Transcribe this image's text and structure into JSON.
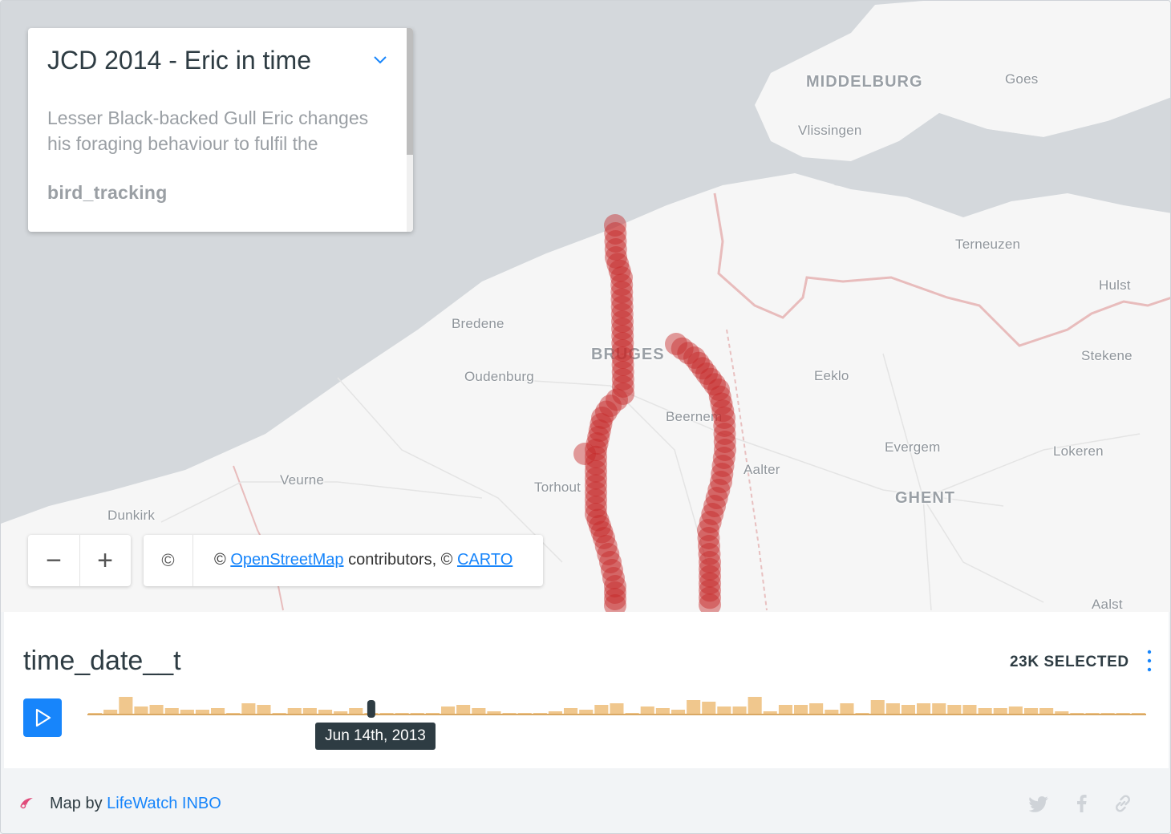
{
  "legend": {
    "title": "JCD 2014 - Eric in time",
    "description": "Lesser Black-backed Gull Eric changes his foraging behaviour to fulfil the",
    "layer_name": "bird_tracking"
  },
  "map": {
    "cities": [
      {
        "name": "MIDDELBURG",
        "major": true
      },
      {
        "name": "Goes",
        "major": false
      },
      {
        "name": "Vlissingen",
        "major": false
      },
      {
        "name": "Terneuzen",
        "major": false
      },
      {
        "name": "Hulst",
        "major": false
      },
      {
        "name": "Bredene",
        "major": false
      },
      {
        "name": "BRUGES",
        "major": true
      },
      {
        "name": "Oudenburg",
        "major": false
      },
      {
        "name": "Eeklo",
        "major": false
      },
      {
        "name": "Stekene",
        "major": false
      },
      {
        "name": "Beernem",
        "major": false
      },
      {
        "name": "Evergem",
        "major": false
      },
      {
        "name": "Lokeren",
        "major": false
      },
      {
        "name": "Aalter",
        "major": false
      },
      {
        "name": "Veurne",
        "major": false
      },
      {
        "name": "Torhout",
        "major": false
      },
      {
        "name": "GHENT",
        "major": true
      },
      {
        "name": "Dunkirk",
        "major": false
      },
      {
        "name": "Aalst",
        "major": false
      }
    ],
    "zoom_out_label": "−",
    "zoom_in_label": "+",
    "attribution_toggle": "©",
    "attribution_prefix": "©",
    "attribution_link1": "OpenStreetMap",
    "attribution_middle": "contributors, ©",
    "attribution_link2": "CARTO",
    "track_color": "#c62828"
  },
  "widget": {
    "title": "time_date__t",
    "selected_count": "23K SELECTED",
    "tooltip": "Jun 14th, 2013",
    "bar_color": "#f0c78d",
    "accent_color": "#1785fb"
  },
  "histogram": {
    "values": [
      1,
      3,
      11,
      5,
      6,
      4,
      3,
      3,
      4,
      1,
      7,
      6,
      1,
      4,
      4,
      3,
      2,
      4,
      1,
      1,
      1,
      1,
      1,
      5,
      6,
      4,
      2,
      1,
      1,
      1,
      2,
      4,
      3,
      6,
      7,
      1,
      5,
      4,
      3,
      9,
      8,
      5,
      5,
      11,
      2,
      6,
      6,
      7,
      3,
      7,
      1,
      9,
      7,
      6,
      7,
      7,
      6,
      6,
      4,
      4,
      5,
      4,
      4,
      2,
      1,
      1,
      1,
      1,
      1
    ],
    "handle_index": 18
  },
  "footer": {
    "prefix": "Map by",
    "author": "LifeWatch INBO",
    "icons": [
      "twitter-icon",
      "facebook-icon",
      "link-icon"
    ]
  }
}
